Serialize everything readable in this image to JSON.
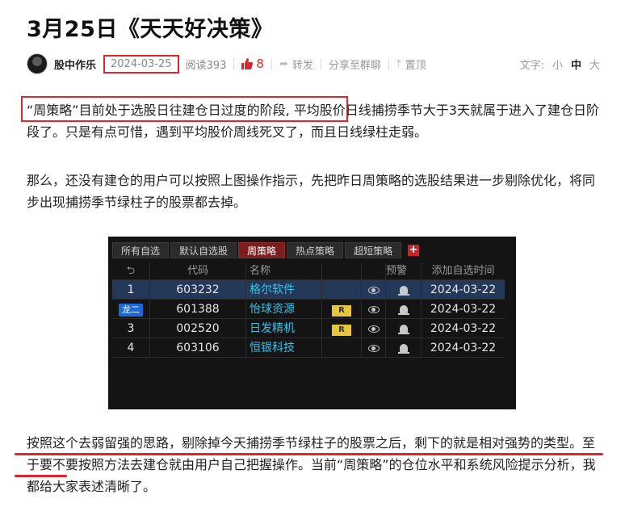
{
  "article": {
    "title": "3月25日《天天好决策",
    "title_end": "》",
    "author": "股中作乐",
    "date": "2024-03-25",
    "reads": "阅读393",
    "likes": "8",
    "forward": "转发",
    "share": "分享至群聊",
    "pin": "置顶",
    "font_label": "文字:",
    "font_small": "小",
    "font_medium": "中",
    "font_large": "大"
  },
  "paragraphs": {
    "p1_highlight": "“周策略”目前处于选股日往建仓日过度的阶段,",
    "p1_rest": "平均股价日线捕捞季节大于3天就属于进入了建仓日阶段了。只是有点可惜，遇到平均股价周线死叉了，而且日线绿柱走弱。",
    "p2": "那么，还没有建仓的用户可以按照上图操作指示，先把昨日周策略的选股结果进一步剔除优化，将同步出现捕捞季节绿柱子的股票都去掉。",
    "p3": "按照这个去弱留强的思路，剔除掉今天捕捞季节绿柱子的股票之后，剩下的就是相对强势的类型。至于要不要按照方法去建仓就由用户自己把握操作。当前“周策略”的仓位水平和系统风险提示分析，我都给大家表述清晰了。"
  },
  "widget": {
    "tabs": [
      "所有自选",
      "默认自选股",
      "周策略",
      "热点策略",
      "超短策略"
    ],
    "active_tab": 2,
    "add_tab": "+",
    "headers": {
      "back": "⮌",
      "code": "代码",
      "name": "名称",
      "alert": "预警",
      "added": "添加自选时间"
    },
    "rows": [
      {
        "idx": "1",
        "badge": "",
        "code": "603232",
        "name": "格尔软件",
        "r": "",
        "date": "2024-03-22"
      },
      {
        "idx": "",
        "badge": "龙二",
        "code": "601388",
        "name": "怡球资源",
        "r": "R",
        "date": "2024-03-22"
      },
      {
        "idx": "3",
        "badge": "",
        "code": "002520",
        "name": "日发精机",
        "r": "R",
        "date": "2024-03-22"
      },
      {
        "idx": "4",
        "badge": "",
        "code": "603106",
        "name": "恒银科技",
        "r": "",
        "date": "2024-03-22"
      }
    ]
  },
  "colors": {
    "accent_red": "#e0262a",
    "stock_name": "#36c3e8",
    "selected_row": "#24385a"
  }
}
